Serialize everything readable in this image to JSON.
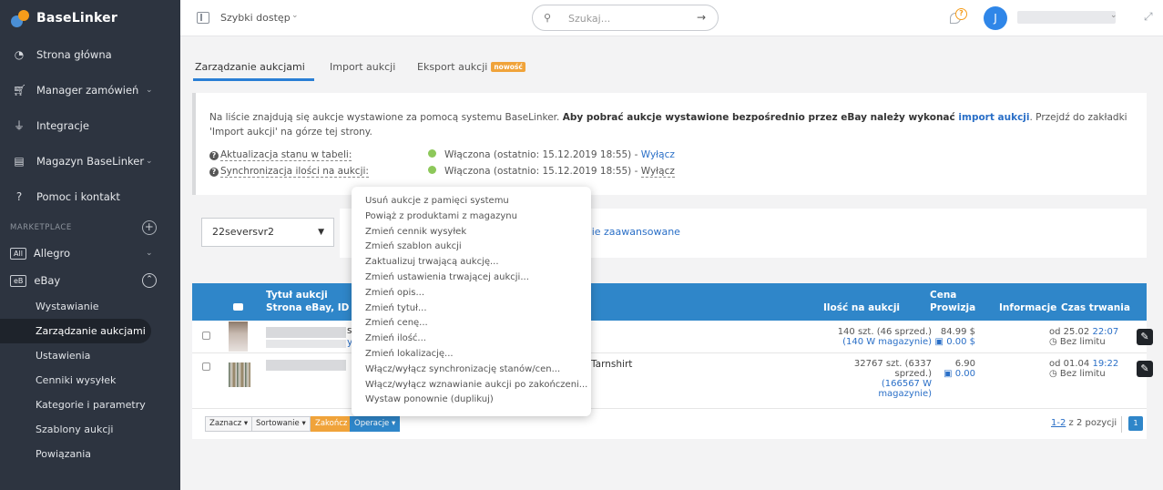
{
  "sidebar": {
    "logo": "BaseLinker",
    "items": [
      {
        "label": "Strona główna"
      },
      {
        "label": "Manager zamówień"
      },
      {
        "label": "Integracje"
      },
      {
        "label": "Magazyn BaseLinker"
      },
      {
        "label": "Pomoc i kontakt"
      }
    ],
    "section_label": "MARKETPLACE",
    "marketplaces": [
      {
        "badge": "All",
        "label": "Allegro"
      },
      {
        "badge": "eB",
        "label": "eBay"
      }
    ],
    "ebay_items": [
      {
        "label": "Wystawianie"
      },
      {
        "label": "Zarządzanie aukcjami"
      },
      {
        "label": "Ustawienia"
      },
      {
        "label": "Cenniki wysyłek"
      },
      {
        "label": "Kategorie i parametry"
      },
      {
        "label": "Szablony aukcji"
      },
      {
        "label": "Powiązania"
      }
    ]
  },
  "topbar": {
    "quick_access": "Szybki dostęp",
    "search_placeholder": "Szukaj...",
    "avatar_letter": "J"
  },
  "tabs": [
    {
      "label": "Zarządzanie aukcjami"
    },
    {
      "label": "Import aukcji"
    },
    {
      "label": "Eksport aukcji",
      "badge": "nowość"
    }
  ],
  "info": {
    "text_1": "Na liście znajdują się aukcje wystawione za pomocą systemu BaseLinker. ",
    "text_bold": "Aby pobrać aukcje wystawione bezpośrednio przez eBay należy wykonać ",
    "link": "import aukcji",
    "text_2": ". Przejdź do zakładki 'Import aukcji' na górze tej strony.",
    "status": [
      {
        "label": "Aktualizacja stanu w tabeli:",
        "value": "Włączona (ostatnio: 15.12.2019 18:55) - ",
        "action": "Wyłącz"
      },
      {
        "label": "Synchronizacja ilości na aukcji:",
        "value": "Włączona (ostatnio: 15.12.2019 18:55) - ",
        "action": "Wyłącz"
      }
    ]
  },
  "filter": {
    "account": "22seversvr2",
    "advanced_search_fragment": "wanie zaawansowane"
  },
  "table": {
    "headers": {
      "title_1": "Tytuł aukcji",
      "title_2": "Strona eBay, ID pro",
      "quantity": "Ilość na aukcji",
      "price_1": "Cena",
      "price_2": "Prowizja",
      "info": "Informacje",
      "duration": "Czas trwania"
    },
    "rows": [
      {
        "title_visible": "s",
        "title_visible_2": "y",
        "qty_1": "140 szt. (46 sprzed.)",
        "qty_2": "(140 W magazynie)",
        "price": "84.99 $",
        "commission": "0.00 $",
        "from": "od 25.02 ",
        "from_time": "22:07",
        "limit": "Bez limitu"
      },
      {
        "title_visible": "Tarnshirt",
        "qty_1": "32767 szt. (6337",
        "qty_2": "sprzed.)",
        "qty_3": "(166567 W",
        "qty_4": "magazynie)",
        "price": "6.90",
        "commission": "0.00",
        "from": "od 01.04 ",
        "from_time": "19:22",
        "limit": "Bez limitu"
      }
    ]
  },
  "footer": {
    "select": "Zaznacz ▾",
    "sort": "Sortowanie ▾",
    "finish": "Zakończ",
    "operations": "Operacje ▾",
    "pager_link": "1-2",
    "pager_text": " z 2 pozycji",
    "page": "1"
  },
  "menu": {
    "items": [
      "Usuń aukcje z pamięci systemu",
      "Powiąż z produktami z magazynu",
      "Zmień cennik wysyłek",
      "Zmień szablon aukcji",
      "Zaktualizuj trwającą aukcję...",
      "Zmień ustawienia trwającej aukcji...",
      "Zmień opis...",
      "Zmień tytuł...",
      "Zmień cenę...",
      "Zmień ilość...",
      "Zmień lokalizację...",
      "Włącz/wyłącz synchronizację stanów/cen...",
      "Włącz/wyłącz wznawianie aukcji po zakończeni...",
      "Wystaw ponownie (duplikuj)"
    ]
  },
  "colors": {
    "sidebar_bg": "#2d3440",
    "accent_blue": "#2f86c9",
    "accent_orange": "#f0a33a",
    "status_green": "#8dc85a"
  }
}
